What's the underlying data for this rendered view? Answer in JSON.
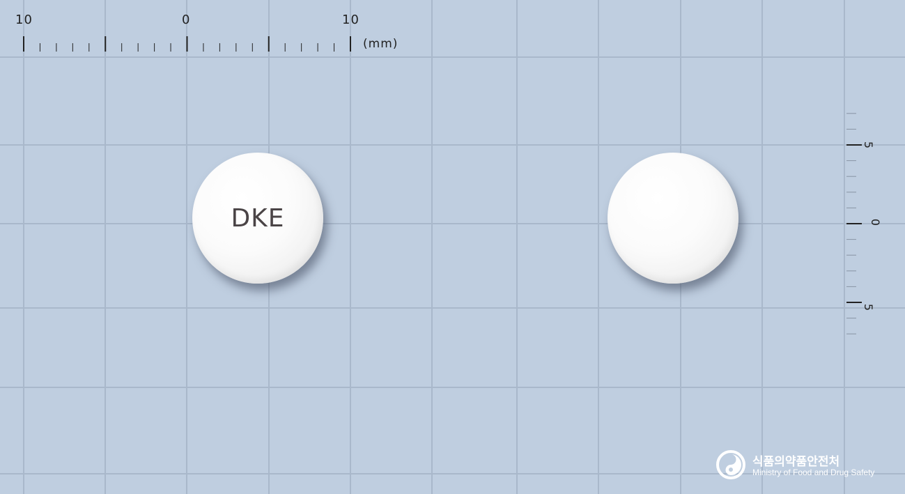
{
  "ruler_top": {
    "labels": [
      "10",
      "0",
      "10"
    ],
    "unit": "(mm)"
  },
  "ruler_right": {
    "labels": [
      "5",
      "0",
      "5"
    ]
  },
  "pills": [
    {
      "side": "front",
      "imprint": "DKE",
      "color": "#ffffff"
    },
    {
      "side": "back",
      "imprint": "",
      "color": "#ffffff"
    }
  ],
  "logo": {
    "icon": "mfds-logo-icon",
    "name_ko": "식품의약품안전처",
    "name_en": "Ministry of Food and Drug Safety"
  },
  "colors": {
    "background": "#bfcee0",
    "grid": "#a9b8cb",
    "ruler_ink": "#222222"
  }
}
